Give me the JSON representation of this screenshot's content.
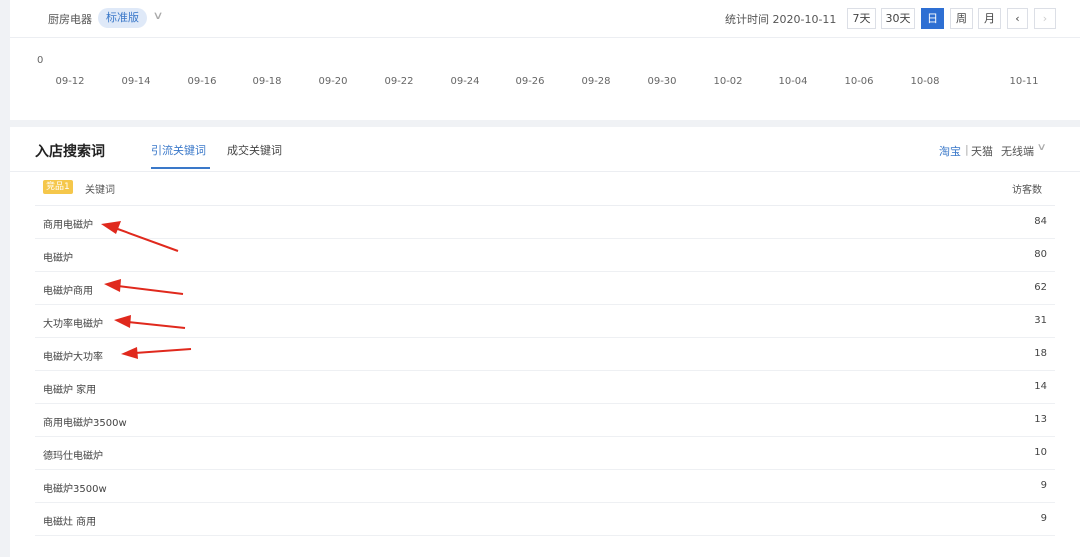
{
  "header": {
    "category": "厨房电器",
    "edition_badge": "标准版",
    "stat_time": "统计时间 2020-10-11",
    "range_buttons": [
      "7天",
      "30天",
      "日",
      "周",
      "月"
    ],
    "active_range": "日"
  },
  "trend_chart": {
    "y_zero": "0",
    "x_ticks": [
      "09-12",
      "09-14",
      "09-16",
      "09-18",
      "09-20",
      "09-22",
      "09-24",
      "09-26",
      "09-28",
      "09-30",
      "10-02",
      "10-04",
      "10-06",
      "10-08",
      "10-11"
    ]
  },
  "search_section": {
    "title": "入店搜索词",
    "tabs": [
      "引流关键词",
      "成交关键词"
    ],
    "active_tab": "引流关键词",
    "platforms": [
      "淘宝",
      "天猫",
      "无线端"
    ],
    "active_platform": "淘宝",
    "header_badge": "竞品1",
    "col_keyword": "关键词",
    "col_visitors": "访客数",
    "rows": [
      {
        "keyword": "商用电磁炉",
        "visitors": "84"
      },
      {
        "keyword": "电磁炉",
        "visitors": "80"
      },
      {
        "keyword": "电磁炉商用",
        "visitors": "62"
      },
      {
        "keyword": "大功率电磁炉",
        "visitors": "31"
      },
      {
        "keyword": "电磁炉大功率",
        "visitors": "18"
      },
      {
        "keyword": "电磁炉 家用",
        "visitors": "14"
      },
      {
        "keyword": "商用电磁炉3500w",
        "visitors": "13"
      },
      {
        "keyword": "德玛仕电磁炉",
        "visitors": "10"
      },
      {
        "keyword": "电磁炉3500w",
        "visitors": "9"
      },
      {
        "keyword": "电磁灶 商用",
        "visitors": "9"
      }
    ]
  },
  "colors": {
    "accent": "#3a78c9",
    "annotation_arrow": "#e0291d",
    "badge_yellow": "#f5c74b"
  }
}
